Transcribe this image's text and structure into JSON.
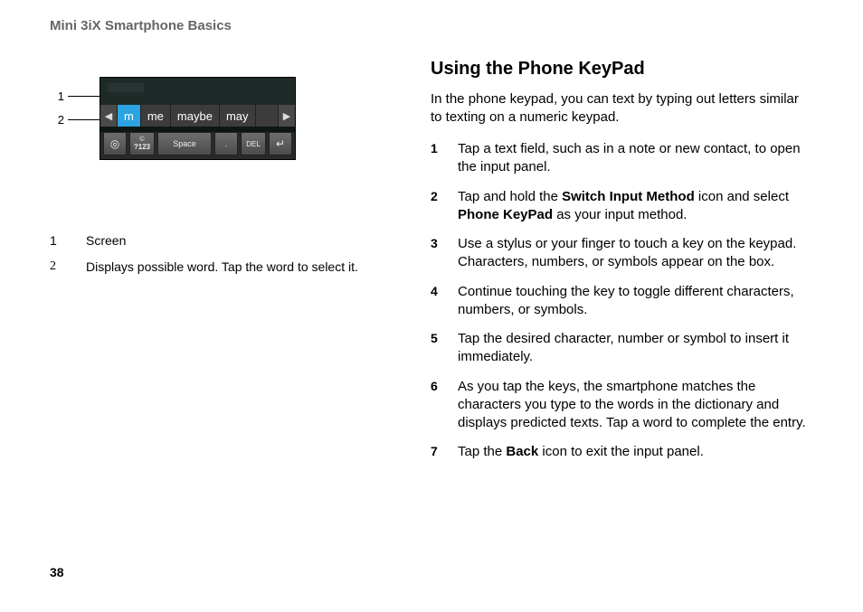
{
  "header": "Mini 3iX Smartphone Basics",
  "page_number": "38",
  "figure": {
    "callouts": [
      "1",
      "2"
    ],
    "suggestions": {
      "prev_arrow": "◀",
      "next_arrow": "▶",
      "words": [
        "m",
        "me",
        "maybe",
        "may"
      ]
    },
    "keys": {
      "nums_top": "©",
      "nums_bottom": "?123",
      "space": "Space",
      "dot": ".",
      "del": "DEL",
      "enter": "↵",
      "globe": "◎"
    }
  },
  "legend": [
    {
      "num": "1",
      "text": "Screen"
    },
    {
      "num": "2",
      "text": "Displays possible word. Tap the word to select it."
    }
  ],
  "section": {
    "title": "Using the Phone KeyPad",
    "intro": "In the phone keypad, you can text by typing out letters similar to texting on a numeric keypad.",
    "steps": [
      {
        "num": "1",
        "parts": [
          {
            "t": "Tap a text field, such as in a note or new contact, to open the input panel."
          }
        ]
      },
      {
        "num": "2",
        "parts": [
          {
            "t": "Tap and hold the "
          },
          {
            "t": "Switch Input Method",
            "b": true
          },
          {
            "t": " icon and select "
          },
          {
            "t": "Phone KeyPad",
            "b": true
          },
          {
            "t": " as your input method."
          }
        ]
      },
      {
        "num": "3",
        "parts": [
          {
            "t": "Use a stylus or your finger to touch a key on the keypad. Characters, numbers, or symbols appear on the box."
          }
        ]
      },
      {
        "num": "4",
        "parts": [
          {
            "t": "Continue touching the key to toggle different characters, numbers, or symbols."
          }
        ]
      },
      {
        "num": "5",
        "parts": [
          {
            "t": "Tap the desired character, number or symbol to insert it immediately."
          }
        ]
      },
      {
        "num": "6",
        "parts": [
          {
            "t": "As you tap the keys, the smartphone matches the characters you type to the words in the dictionary and displays predicted texts. Tap a word to complete the entry."
          }
        ]
      },
      {
        "num": "7",
        "parts": [
          {
            "t": "Tap the "
          },
          {
            "t": "Back",
            "b": true
          },
          {
            "t": " icon to exit the input panel."
          }
        ]
      }
    ]
  }
}
